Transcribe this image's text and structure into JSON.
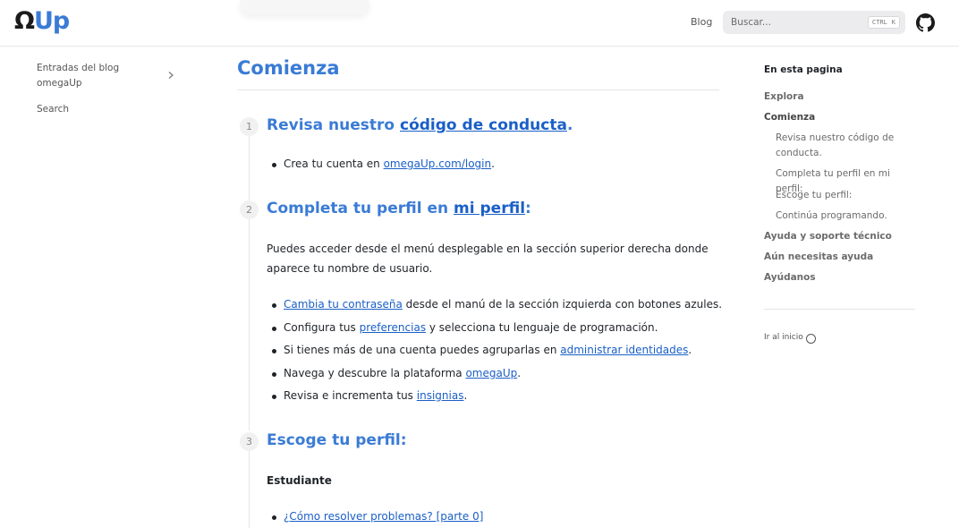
{
  "header": {
    "logo_omega": "Ω",
    "logo_up": "Up",
    "blog": "Blog",
    "search_placeholder": "Buscar...",
    "kbd_ctrl": "CTRL",
    "kbd_k": "K",
    "github_icon": "github-icon"
  },
  "sidebar": {
    "items": [
      {
        "label_line1": "Entradas del blog",
        "label_line2": "omegaUp"
      },
      {
        "label": "Search"
      }
    ]
  },
  "main": {
    "title": "Comienza",
    "steps": [
      {
        "number": "1",
        "heading_text": "Revisa nuestro ",
        "heading_link": "código de conducta",
        "heading_suffix": ".",
        "items": [
          {
            "prefix": "Crea tu cuenta en ",
            "link": "omegaUp.com/login",
            "suffix": "."
          }
        ]
      },
      {
        "number": "2",
        "heading_text": "Completa tu perfil en ",
        "heading_link": "mi perfil",
        "heading_suffix": ":",
        "paragraph": "Puedes acceder desde el menú desplegable en la sección superior derecha donde aparece tu nombre de usuario.",
        "items": [
          {
            "prefix": "",
            "link": "Cambia tu contraseña",
            "suffix": " desde el manú de la sección izquierda con botones azules."
          },
          {
            "prefix": "Configura tus ",
            "link": "preferencias",
            "suffix": " y selecciona tu lenguaje de programación."
          },
          {
            "prefix": "Si tienes más de una cuenta puedes agruparlas en ",
            "link": "administrar identidades",
            "suffix": "."
          },
          {
            "prefix": "Navega y descubre la plataforma ",
            "link": "omegaUp",
            "suffix": "."
          },
          {
            "prefix": "Revisa e incrementa tus ",
            "link": "insignias",
            "suffix": "."
          }
        ]
      },
      {
        "number": "3",
        "heading_text": "Escoge tu perfil:",
        "subheading": "Estudiante",
        "items": [
          {
            "prefix": "",
            "link": "¿Cómo resolver problemas? [parte 0]",
            "suffix": ""
          }
        ]
      }
    ]
  },
  "toc": {
    "title": "En esta pagina",
    "items": [
      {
        "label": "Explora",
        "level": 1
      },
      {
        "label": "Comienza",
        "level": 1
      },
      {
        "label": "Revisa nuestro código de conducta.",
        "level": 2
      },
      {
        "label": "Completa tu perfil en mi perfil:",
        "level": 2
      },
      {
        "label": "Escoge tu perfil:",
        "level": 2
      },
      {
        "label": "Continúa programando.",
        "level": 2
      },
      {
        "label": "Ayuda y soporte técnico",
        "level": 1
      },
      {
        "label": "Aún necesitas ayuda",
        "level": 1
      },
      {
        "label": "Ayúdanos",
        "level": 1
      }
    ],
    "back_to_top": "Ir al inicio"
  },
  "colors": {
    "accent": "#3a7bd5",
    "link": "#1a5fc7"
  }
}
